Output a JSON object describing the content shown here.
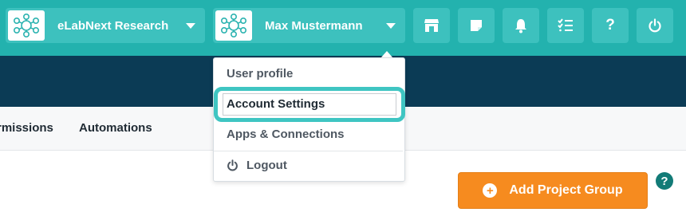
{
  "header": {
    "org_name": "eLabNext Research",
    "user_name": "Max Mustermann",
    "icons": [
      "store-icon",
      "notes-icon",
      "bell-icon",
      "checklist-icon",
      "help-icon",
      "power-icon"
    ],
    "help_glyph": "?"
  },
  "user_menu": {
    "items": [
      {
        "label": "User profile"
      },
      {
        "label": "Account Settings"
      },
      {
        "label": "Apps & Connections"
      },
      {
        "label": "Logout",
        "icon": "power-icon"
      }
    ],
    "highlighted": "Account Settings"
  },
  "tabs": [
    "rmissions",
    "Automations"
  ],
  "actions": {
    "add_project_group": "Add Project Group",
    "plus_glyph": "+",
    "help_glyph": "?"
  },
  "colors": {
    "brand_teal": "#23b2ae",
    "pill_teal": "#3dc1be",
    "navy": "#0b3b55",
    "orange": "#f68b1f",
    "highlight_ring": "#3fc5c2"
  }
}
